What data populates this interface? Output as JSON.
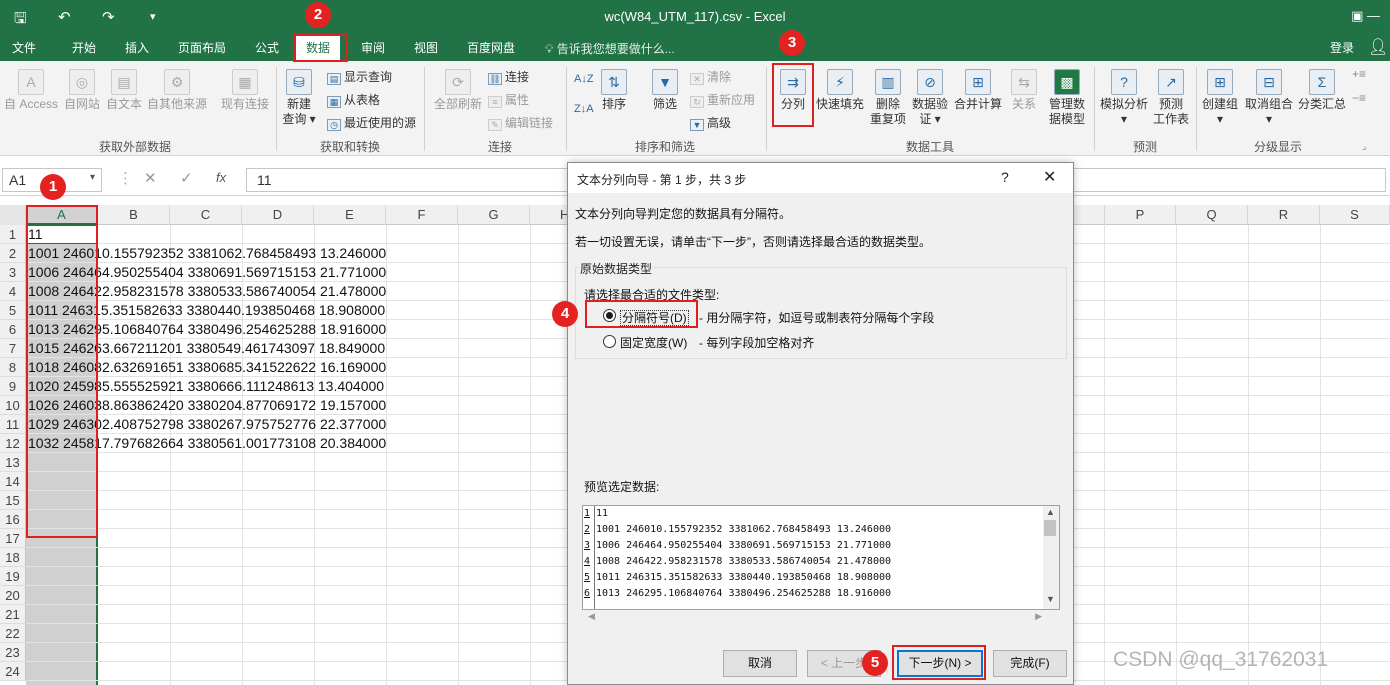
{
  "window": {
    "title": "wc(W84_UTM_117).csv - Excel",
    "icons": [
      "save-icon",
      "undo-icon",
      "redo-icon",
      "customize-qat-icon"
    ],
    "controls": "▣   —"
  },
  "menu": {
    "tabs": [
      "文件",
      "开始",
      "插入",
      "页面布局",
      "公式",
      "数据",
      "审阅",
      "视图",
      "百度网盘"
    ],
    "active": "数据",
    "tell_me": "告诉我您想要做什么...",
    "login": "登录"
  },
  "ribbon": {
    "get_external": {
      "group": "获取外部数据",
      "buttons": [
        "自 Access",
        "自网站",
        "自文本",
        "自其他来源",
        "现有连接"
      ]
    },
    "get_transform": {
      "group": "获取和转换",
      "new_query": "新建",
      "new_query_2": "查询",
      "items": [
        "显示查询",
        "从表格",
        "最近使用的源"
      ]
    },
    "connections": {
      "group": "连接",
      "refresh_all": "全部刷新",
      "items": [
        "连接",
        "属性",
        "编辑链接"
      ]
    },
    "sort_filter": {
      "group": "排序和筛选",
      "sort": "排序",
      "filter": "筛选",
      "items": [
        "清除",
        "重新应用",
        "高级"
      ]
    },
    "data_tools": {
      "group": "数据工具",
      "text_to_columns": "分列",
      "flash_fill": "快速填充",
      "remove_dup": "删除",
      "remove_dup_2": "重复项",
      "validation": "数据验",
      "validation_2": "证",
      "consolidate": "合并计算",
      "relations": "关系",
      "manage_model": "管理数",
      "manage_model_2": "据模型"
    },
    "forecast": {
      "group": "预测",
      "whatif": "模拟分析",
      "forecast_sheet": "预测",
      "forecast_sheet_2": "工作表"
    },
    "outline": {
      "group": "分级显示",
      "group_btn": "创建组",
      "ungroup": "取消组合",
      "subtotal": "分类汇总"
    }
  },
  "formula_bar": {
    "name_box": "A1",
    "formula": "11"
  },
  "sheet": {
    "columns": [
      "A",
      "B",
      "C",
      "D",
      "E",
      "F",
      "G",
      "H",
      "P",
      "Q",
      "R",
      "S"
    ],
    "selected_column": "A",
    "rows": [
      "11",
      "1001 246010.155792352 3381062.768458493 13.246000",
      "1006 246464.950255404 3380691.569715153 21.771000",
      "1008 246422.958231578 3380533.586740054 21.478000",
      "1011 246315.351582633 3380440.193850468 18.908000",
      "1013 246295.106840764 3380496.254625288 18.916000",
      "1015 246263.667211201 3380549.461743097 18.849000",
      "1018 246082.632691651 3380685.341522622 16.169000",
      "1020 245985.555525921 3380666.111248613 13.404000",
      "1026 246038.863862420 3380204.877069172 19.157000",
      "1029 246302.408752798 3380267.975752776 22.377000",
      "1032 245817.797682664 3380561.001773108 20.384000"
    ],
    "row_numbers": [
      "1",
      "2",
      "3",
      "4",
      "5",
      "6",
      "7",
      "8",
      "9",
      "10",
      "11",
      "12",
      "13",
      "14",
      "15",
      "16",
      "17",
      "18",
      "19",
      "20",
      "21",
      "22",
      "23",
      "24"
    ]
  },
  "dialog": {
    "title": "文本分列向导 - 第 1 步，共 3 步",
    "help": "?",
    "close": "✕",
    "intro": "文本分列向导判定您的数据具有分隔符。",
    "instruction": "若一切设置无误，请单击“下一步”，否则请选择最合适的数据类型。",
    "group_title": "原始数据类型",
    "prompt": "请选择最合适的文件类型:",
    "option_delimited": "分隔符号(D)",
    "option_delimited_desc": "- 用分隔字符，如逗号或制表符分隔每个字段",
    "option_fixed": "固定宽度(W)",
    "option_fixed_desc": "- 每列字段加空格对齐",
    "selected_option": "delimited",
    "preview_label": "预览选定数据:",
    "preview_lines": [
      {
        "n": "1",
        "text": "11"
      },
      {
        "n": "2",
        "text": "1001 246010.155792352 3381062.768458493 13.246000"
      },
      {
        "n": "3",
        "text": "1006 246464.950255404 3380691.569715153 21.771000"
      },
      {
        "n": "4",
        "text": "1008 246422.958231578 3380533.586740054 21.478000"
      },
      {
        "n": "5",
        "text": "1011 246315.351582633 3380440.193850468 18.908000"
      },
      {
        "n": "6",
        "text": "1013 246295.106840764 3380496.254625288 18.916000"
      }
    ],
    "btn_cancel": "取消",
    "btn_prev": "< 上一步",
    "btn_next": "下一步(N) >",
    "btn_finish": "完成(F)"
  },
  "annotations": [
    "1",
    "2",
    "3",
    "4",
    "5"
  ],
  "watermark": "CSDN @qq_31762031",
  "colors": {
    "excel_green": "#217346",
    "annotation_red": "#e02020",
    "selection_gray": "#d0d0d0"
  }
}
